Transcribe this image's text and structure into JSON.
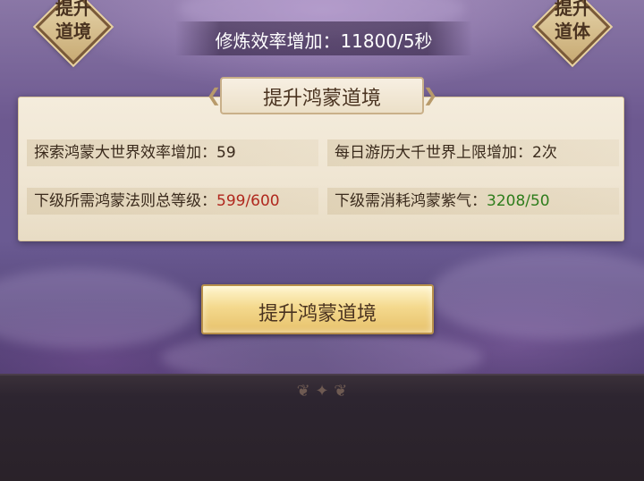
{
  "top_left_button": {
    "label": "提升\n道境",
    "icon": "diamond-frame"
  },
  "top_right_button": {
    "label": "提升\n道体",
    "icon": "diamond-frame"
  },
  "efficiency_banner": {
    "text": "修炼效率增加：11800/5秒"
  },
  "panel": {
    "title": "提升鸿蒙道境",
    "stats": [
      {
        "label": "探索鸿蒙大世界效率增加：",
        "value": "59"
      },
      {
        "label": "每日游历大千世界上限增加：",
        "value": "2次"
      },
      {
        "label": "下级所需鸿蒙法则总等级：",
        "value": "599/600",
        "value_color": "#b0281e"
      },
      {
        "label": "下级需消耗鸿蒙紫气：",
        "value": "3208/50",
        "value_color": "#2e7d1c"
      }
    ]
  },
  "action_button": {
    "label": "提升鸿蒙道境"
  }
}
